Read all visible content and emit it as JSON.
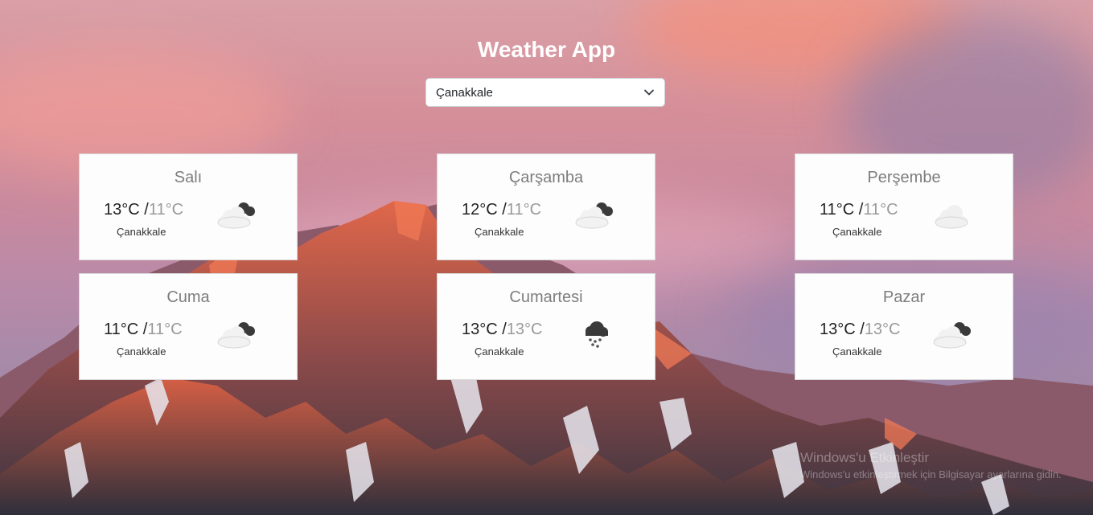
{
  "app": {
    "title": "Weather App"
  },
  "city_select": {
    "selected": "Çanakkale"
  },
  "forecast": [
    {
      "day": "Salı",
      "high": "13°C",
      "sep": " /",
      "low": "11°C",
      "location": "Çanakkale",
      "icon": "cloud-sun-icon"
    },
    {
      "day": "Çarşamba",
      "high": "12°C",
      "sep": " /",
      "low": "11°C",
      "location": "Çanakkale",
      "icon": "cloud-sun-icon"
    },
    {
      "day": "Perşembe",
      "high": "11°C",
      "sep": " /",
      "low": "11°C",
      "location": "Çanakkale",
      "icon": "cloud-icon"
    },
    {
      "day": "Cuma",
      "high": "11°C",
      "sep": " /",
      "low": "11°C",
      "location": "Çanakkale",
      "icon": "cloud-sun-icon"
    },
    {
      "day": "Cumartesi",
      "high": "13°C",
      "sep": " /",
      "low": "13°C",
      "location": "Çanakkale",
      "icon": "snow-cloud-icon"
    },
    {
      "day": "Pazar",
      "high": "13°C",
      "sep": " /",
      "low": "13°C",
      "location": "Çanakkale",
      "icon": "cloud-sun-icon"
    }
  ],
  "watermark": {
    "line1": "Windows'u Etkinleştir",
    "line2": "Windows'u etkinleştirmek için Bilgisayar ayarlarına gidin."
  }
}
